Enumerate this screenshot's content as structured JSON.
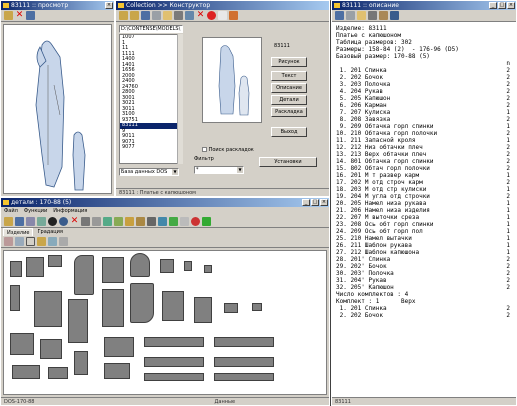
{
  "win_preview": {
    "title": "83111 :: просмотр",
    "status": ""
  },
  "win_catalog": {
    "title": "Collection >> Конструктор",
    "path": "D:\\CONTENSE\\MODELS\\",
    "model_code": "83111",
    "models": [
      "1007",
      "1",
      "11",
      "1111",
      "1400",
      "1401",
      "1656",
      "2000",
      "2400",
      "24760",
      "2800",
      "3001",
      "3021",
      "3011",
      "3100",
      "93751",
      "83111",
      "9",
      "9011",
      "9071",
      "9077"
    ],
    "selected_model": "83111",
    "buttons": [
      "Рисунок",
      "Текст",
      "Описание",
      "Детали",
      "Раскладка",
      "Выход"
    ],
    "search_label": "Поиск раскладок",
    "filter_label": "Фильтр",
    "db_label": "База данных DOS",
    "filter_value": "*",
    "install_button": "Установки",
    "status": "83111 : Платье с капюшоном"
  },
  "win_details": {
    "title": "детали : 170-88 (5)",
    "menu": [
      "Файл",
      "Функции",
      "Информация"
    ],
    "tabs": [
      "Изделие",
      "Градация"
    ],
    "status": [
      "DOS-170-88",
      "Данные"
    ]
  },
  "win_spec": {
    "title": "83111 :: описание",
    "status": "83111",
    "lines": [
      {
        "t": "Изделие: 83111",
        "n": ""
      },
      {
        "t": "Платье с капюшоном",
        "n": ""
      },
      {
        "t": "Таблица размеров: 302",
        "n": ""
      },
      {
        "t": "Размеры: 158-84 (2)  - 176-96 (D5)",
        "n": ""
      },
      {
        "t": "Базовый размер: 170-88 (5)",
        "n": ""
      },
      {
        "t": "",
        "n": ""
      },
      {
        "t": "",
        "n": "n"
      },
      {
        "t": " 1. 201 Спинка",
        "n": "2"
      },
      {
        "t": " 2. 202 Бочок",
        "n": "2"
      },
      {
        "t": " 3. 203 Полочка",
        "n": "2"
      },
      {
        "t": " 4. 204 Рукав",
        "n": "2"
      },
      {
        "t": " 5. 205 Капюшон",
        "n": "2"
      },
      {
        "t": " 6. 206 Карман",
        "n": "2"
      },
      {
        "t": " 7. 207 Кулиска",
        "n": "1"
      },
      {
        "t": " 8. 208 Завязка",
        "n": "2"
      },
      {
        "t": " 9. 209 Обтачка горл спинки",
        "n": "1"
      },
      {
        "t": "10. 210 Обтачка горл полочки",
        "n": "2"
      },
      {
        "t": "11. 211 Запасной кроля",
        "n": "1"
      },
      {
        "t": "12. 212 Низ обтачки плеч",
        "n": "2"
      },
      {
        "t": "13. 213 Верх обтачки плеч",
        "n": "2"
      },
      {
        "t": "14. 801 Обтачка горл спинки",
        "n": "2"
      },
      {
        "t": "15. 802 Обтач горл полочки",
        "n": "2"
      },
      {
        "t": "16. 201 М т развер карм",
        "n": "1"
      },
      {
        "t": "17. 202 М отд строч карм",
        "n": "2"
      },
      {
        "t": "18. 203 М отд стр кулиски",
        "n": "1"
      },
      {
        "t": "19. 204 М угла отд строчки",
        "n": "2"
      },
      {
        "t": "20. 205 Намел низа рукава",
        "n": "1"
      },
      {
        "t": "21. 206 Намел низа изделия",
        "n": "1"
      },
      {
        "t": "22. 207 М выточки среза",
        "n": "1"
      },
      {
        "t": "23. 208 Ось обт горл спинки",
        "n": "1"
      },
      {
        "t": "24. 209 Ось обт горл пол",
        "n": "1"
      },
      {
        "t": "25. 210 Намел вытачки",
        "n": "1"
      },
      {
        "t": "26. 211 Шаблон рукава",
        "n": "1"
      },
      {
        "t": "27. 212 Шаблон капюшона",
        "n": "1"
      },
      {
        "t": "28. 201' Спинка",
        "n": "2"
      },
      {
        "t": "29. 202' Бочок",
        "n": "2"
      },
      {
        "t": "30. 203' Полочка",
        "n": "2"
      },
      {
        "t": "31. 204' Рукав",
        "n": "2"
      },
      {
        "t": "32. 205' Капюшон",
        "n": "2"
      },
      {
        "t": "",
        "n": ""
      },
      {
        "t": "Число комплектов : 4",
        "n": ""
      },
      {
        "t": "",
        "n": ""
      },
      {
        "t": "Комплект : 1      Верх",
        "n": ""
      },
      {
        "t": " 1. 201 Спинка",
        "n": "2"
      },
      {
        "t": " 2. 202 Бочок",
        "n": "2"
      }
    ]
  }
}
